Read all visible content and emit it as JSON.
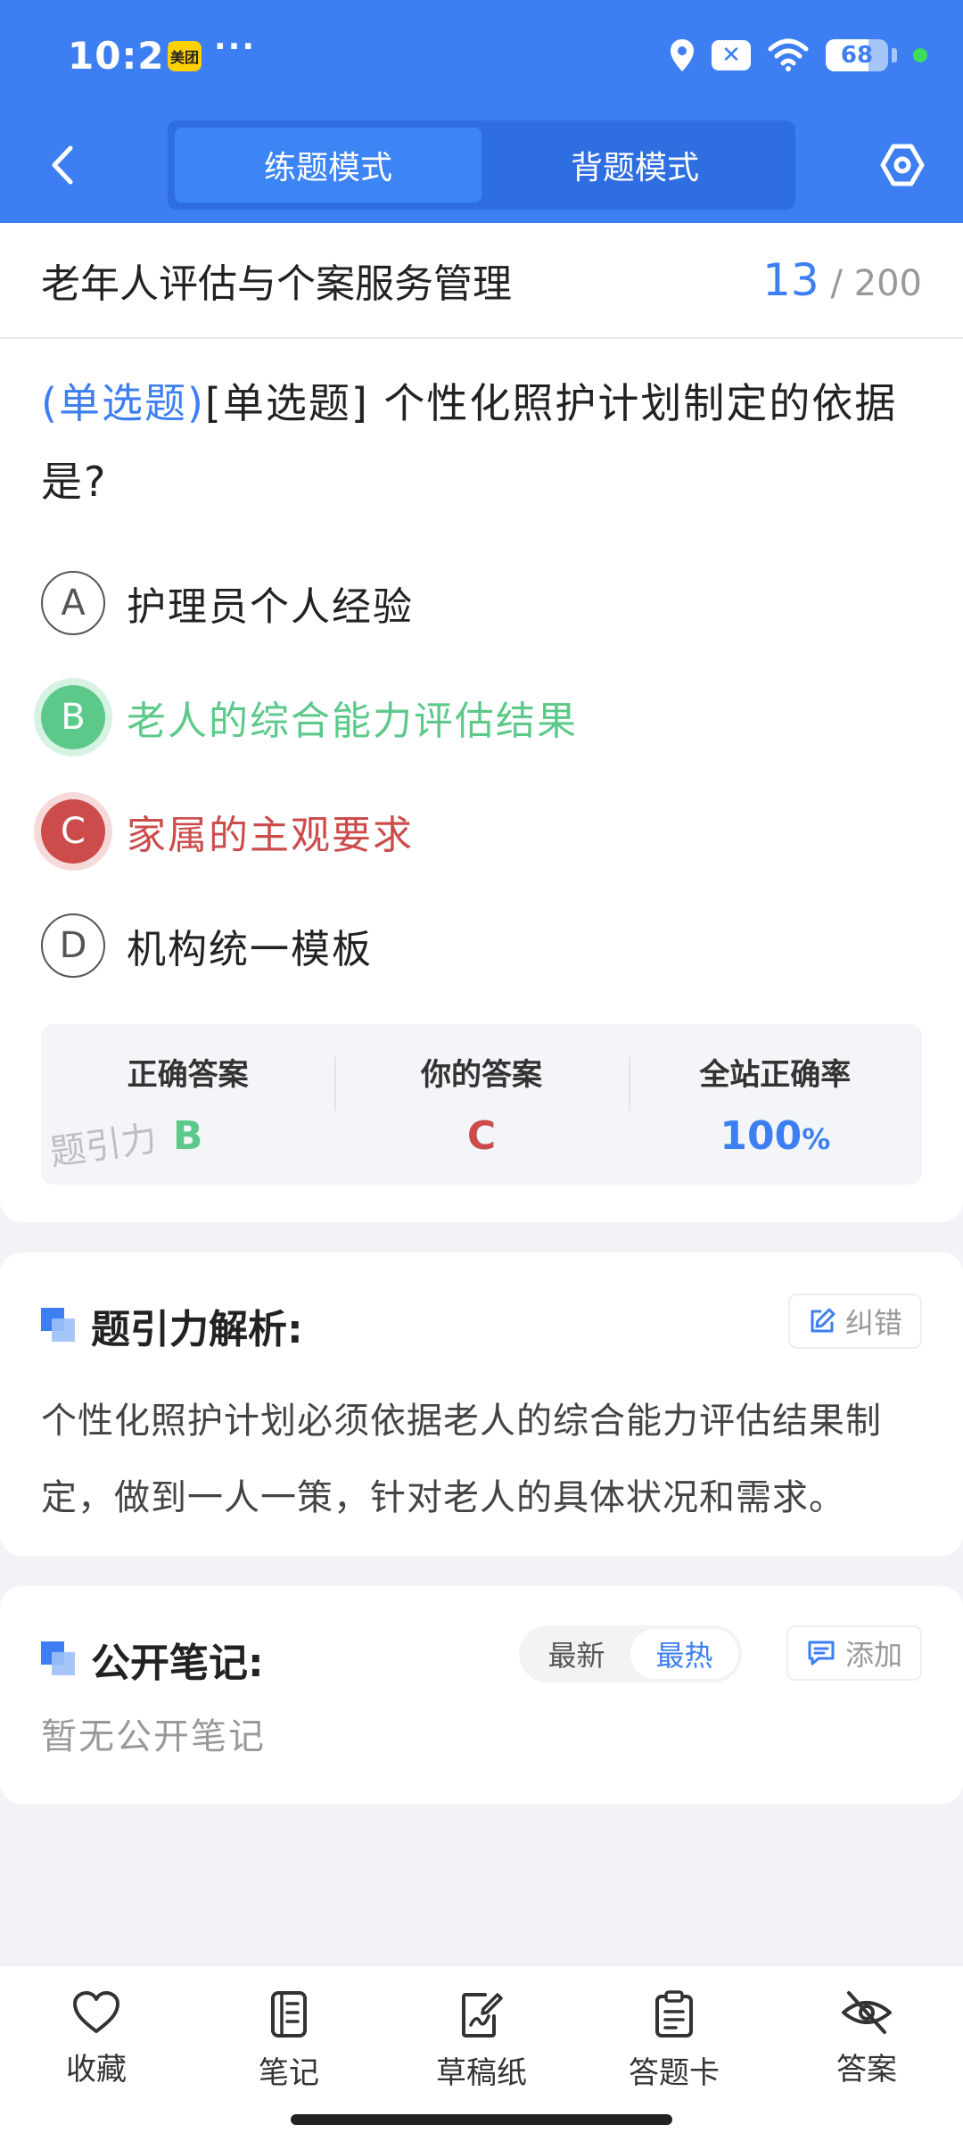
{
  "status_bar": {
    "time": "10:21",
    "app_badge": "美团",
    "more_dots": "···",
    "battery_level": "68"
  },
  "nav": {
    "tabs": [
      {
        "label": "练题模式",
        "active": true
      },
      {
        "label": "背题模式",
        "active": false
      }
    ]
  },
  "question": {
    "subject": "老年人评估与个案服务管理",
    "current_index": "13",
    "progress_sep": "/",
    "total": "200",
    "type_tag": "(单选题)",
    "text": "[单选题] 个性化照护计划制定的依据是?",
    "options": [
      {
        "letter": "A",
        "text": "护理员个人经验",
        "state": "normal"
      },
      {
        "letter": "B",
        "text": "老人的综合能力评估结果",
        "state": "correct"
      },
      {
        "letter": "C",
        "text": "家属的主观要求",
        "state": "wrong"
      },
      {
        "letter": "D",
        "text": "机构统一模板",
        "state": "normal"
      }
    ]
  },
  "answer_summary": {
    "correct_label": "正确答案",
    "correct_value": "B",
    "yours_label": "你的答案",
    "yours_value": "C",
    "rate_label": "全站正确率",
    "rate_value": "100",
    "rate_unit": "%",
    "watermark": "题引力"
  },
  "analysis": {
    "title": "题引力解析:",
    "report_label": "纠错",
    "text": "个性化照护计划必须依据老人的综合能力评估结果制定，做到一人一策，针对老人的具体状况和需求。"
  },
  "notes": {
    "title": "公开笔记:",
    "sort_options": [
      {
        "label": "最新",
        "active": false
      },
      {
        "label": "最热",
        "active": true
      }
    ],
    "add_label": "添加",
    "empty_text": "暂无公开笔记"
  },
  "bottom_bar": {
    "items": [
      {
        "label": "收藏",
        "icon": "heart-icon"
      },
      {
        "label": "笔记",
        "icon": "notebook-icon"
      },
      {
        "label": "草稿纸",
        "icon": "draft-icon"
      },
      {
        "label": "答题卡",
        "icon": "clipboard-icon"
      },
      {
        "label": "答案",
        "icon": "eye-off-icon"
      }
    ]
  },
  "colors": {
    "primary": "#3d7ff2",
    "correct": "#5cc98a",
    "wrong": "#cc4c4c"
  }
}
